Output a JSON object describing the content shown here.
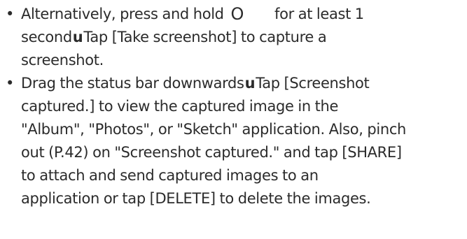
{
  "instructions": {
    "bullet_symbol": "•",
    "item1": {
      "part_a": "Alternatively, press and hold",
      "power_key": "O",
      "part_b": "for at least 1",
      "part_c": "second",
      "arrow": "u",
      "part_d": "Tap [Take screenshot] to capture a",
      "part_e": "screenshot."
    },
    "item2": {
      "part_a": "Drag the status bar downwards",
      "arrow": "u",
      "part_b": "Tap [Screenshot",
      "line2": "captured.] to view the captured image in the",
      "line3": "\"Album\", \"Photos\", or \"Sketch\" application. Also, pinch",
      "line4": "out (P.42) on \"Screenshot captured.\" and tap [SHARE]",
      "line5": "to attach and send captured images to an",
      "line6": "application or tap [DELETE] to delete the images."
    }
  }
}
